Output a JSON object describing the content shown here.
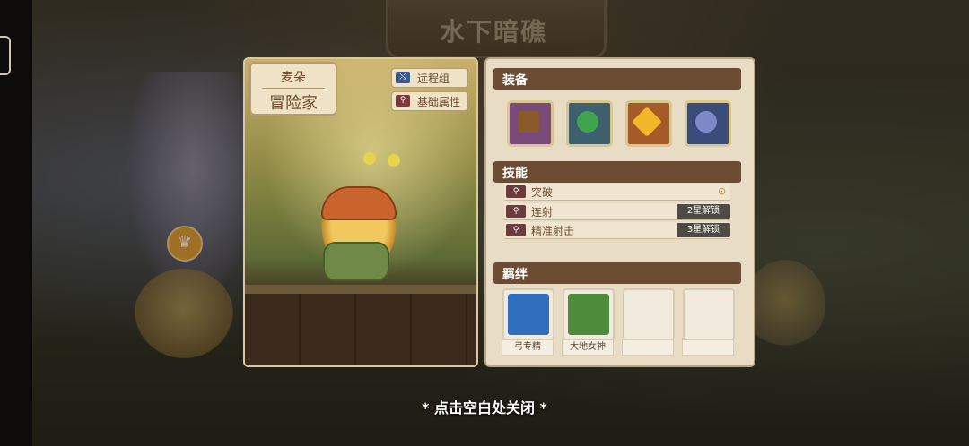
{
  "background": {
    "stage_title": "水下暗礁"
  },
  "hero_card": {
    "name": "麦朵",
    "title": "冒险家",
    "tags": [
      {
        "label": "远程组",
        "icon": "bow-icon",
        "color": "#3d5a8a"
      },
      {
        "label": "基础属性",
        "icon": "magnifier-icon",
        "color": "#7a3a3a"
      }
    ]
  },
  "panel": {
    "equipment": {
      "heading": "装备",
      "slots": [
        {
          "icon": "crossbow-icon",
          "frame": "#7a4a7a",
          "gem": "#8a5a2c"
        },
        {
          "icon": "green-gem-icon",
          "frame": "#3d5f6e",
          "gem": "#3ea54e"
        },
        {
          "icon": "gold-gem-icon",
          "frame": "#a55a28",
          "gem": "#f3b72c"
        },
        {
          "icon": "blue-gem-icon",
          "frame": "#3b4c7a",
          "gem": "#7e89c9"
        }
      ]
    },
    "skills": {
      "heading": "技能",
      "items": [
        {
          "name": "突破",
          "status": ""
        },
        {
          "name": "连射",
          "status": "2星解锁"
        },
        {
          "name": "精准射击",
          "status": "3星解锁"
        }
      ]
    },
    "bonds": {
      "heading": "羁绊",
      "items": [
        {
          "label": "弓专精",
          "icon": "bow-mastery-icon",
          "color": "#2f6fbd"
        },
        {
          "label": "大地女神",
          "icon": "earth-tree-icon",
          "color": "#4d8a3a"
        },
        {
          "label": "",
          "icon": "",
          "color": ""
        },
        {
          "label": "",
          "icon": "",
          "color": ""
        }
      ]
    }
  },
  "close_hint": "* 点击空白处关闭 *"
}
